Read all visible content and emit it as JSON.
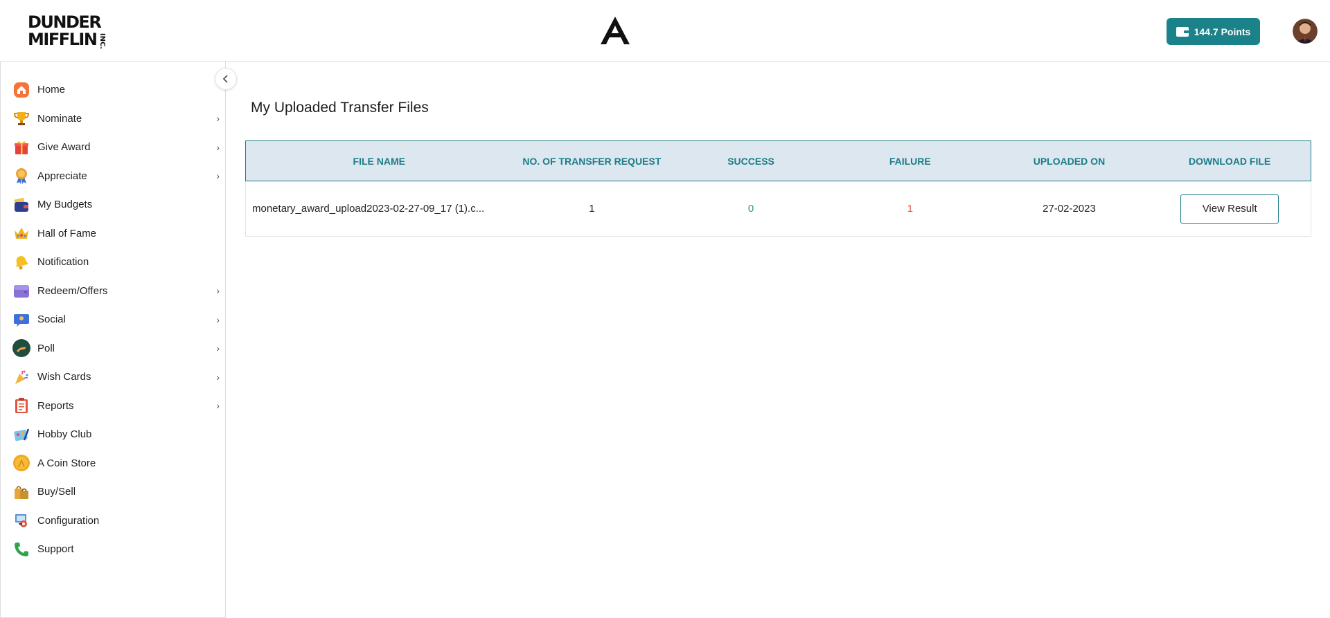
{
  "brand": {
    "logo_line1": "DUNDER",
    "logo_line2": "MIFFLIN",
    "logo_inc": "INC."
  },
  "header": {
    "points_label": "144.7  Points",
    "colors": {
      "accent": "#1b8289"
    }
  },
  "sidebar": {
    "items": [
      {
        "label": "Home",
        "icon": "home-icon",
        "has_submenu": false
      },
      {
        "label": "Nominate",
        "icon": "trophy-icon",
        "has_submenu": true
      },
      {
        "label": "Give Award",
        "icon": "gift-icon",
        "has_submenu": true
      },
      {
        "label": "Appreciate",
        "icon": "medal-icon",
        "has_submenu": true
      },
      {
        "label": "My Budgets",
        "icon": "wallet-icon",
        "has_submenu": false
      },
      {
        "label": "Hall of Fame",
        "icon": "crown-icon",
        "has_submenu": false
      },
      {
        "label": "Notification",
        "icon": "bell-icon",
        "has_submenu": false
      },
      {
        "label": "Redeem/Offers",
        "icon": "purse-icon",
        "has_submenu": true
      },
      {
        "label": "Social",
        "icon": "chat-icon",
        "has_submenu": true
      },
      {
        "label": "Poll",
        "icon": "poll-icon",
        "has_submenu": true
      },
      {
        "label": "Wish Cards",
        "icon": "party-popper-icon",
        "has_submenu": true
      },
      {
        "label": "Reports",
        "icon": "clipboard-icon",
        "has_submenu": true
      },
      {
        "label": "Hobby Club",
        "icon": "palette-icon",
        "has_submenu": false
      },
      {
        "label": "A Coin Store",
        "icon": "coin-icon",
        "has_submenu": false
      },
      {
        "label": "Buy/Sell",
        "icon": "shopping-bags-icon",
        "has_submenu": false
      },
      {
        "label": "Configuration",
        "icon": "config-icon",
        "has_submenu": false
      },
      {
        "label": "Support",
        "icon": "phone-icon",
        "has_submenu": false
      }
    ]
  },
  "main": {
    "title": "My Uploaded Transfer Files",
    "table": {
      "columns": [
        "FILE NAME",
        "NO. OF TRANSFER REQUEST",
        "SUCCESS",
        "FAILURE",
        "UPLOADED ON",
        "DOWNLOAD FILE"
      ],
      "rows": [
        {
          "file_name": "monetary_award_upload2023-02-27-09_17 (1).c...",
          "requests": "1",
          "success": "0",
          "failure": "1",
          "uploaded_on": "27-02-2023",
          "action_label": "View Result"
        }
      ]
    }
  }
}
